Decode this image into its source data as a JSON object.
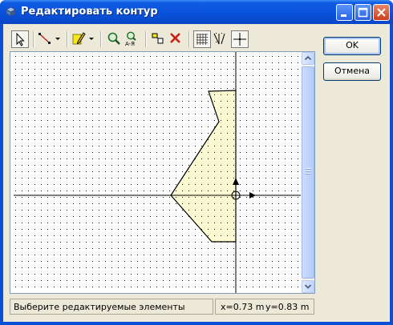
{
  "window": {
    "title": "Редактировать контур"
  },
  "title_buttons": [
    "minimize",
    "maximize",
    "close"
  ],
  "toolbar": {
    "tools": [
      {
        "icon": "select-arrow-icon",
        "pressed": true
      },
      {
        "icon": "line-tool-icon",
        "dropdown": true
      },
      {
        "icon": "pencil-icon",
        "dropdown": true
      },
      {
        "icon": "zoom-icon"
      },
      {
        "icon": "zoom-extents-icon"
      },
      {
        "icon": "align-objects-icon"
      },
      {
        "icon": "delete-icon"
      },
      {
        "icon": "grid-icon",
        "pressed": true
      },
      {
        "icon": "snap-points-icon"
      },
      {
        "icon": "origin-axes-icon",
        "pressed": true
      }
    ]
  },
  "dialog_buttons": {
    "ok_label": "OK",
    "cancel_label": "Отмена"
  },
  "status": {
    "message": "Выберите редактируемые элементы",
    "x_readout": "x=0.73 m",
    "y_readout": "y=0.83 m"
  },
  "colors": {
    "titlebar": "#0a52db",
    "shape_fill": "#fdfbd3",
    "face": "#ece9d8",
    "grid_dot": "#000000"
  }
}
